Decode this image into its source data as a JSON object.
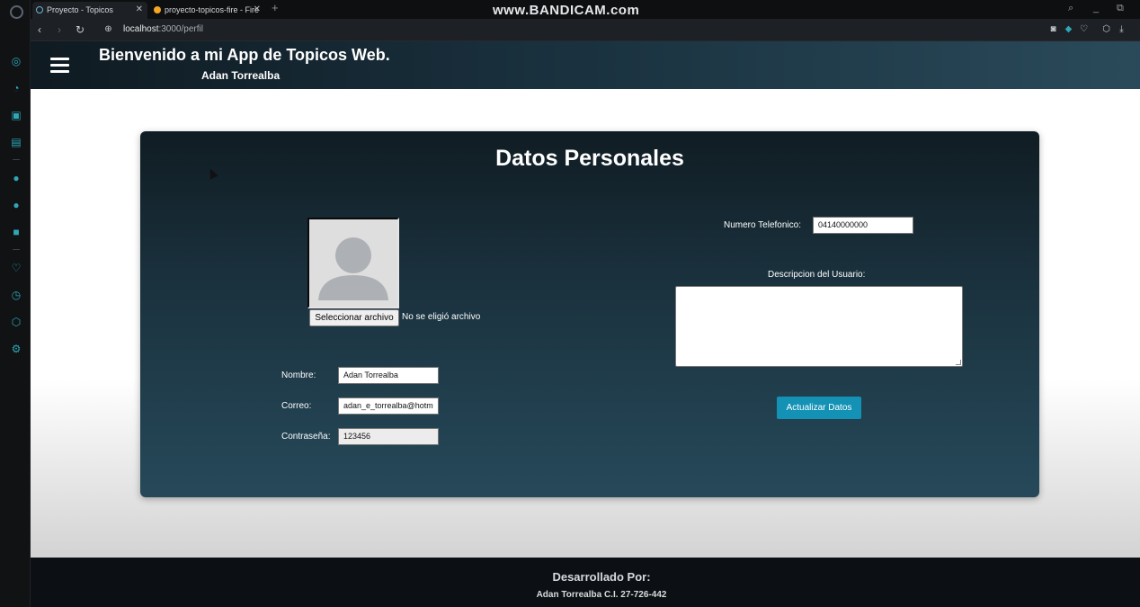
{
  "browser": {
    "tabs": [
      {
        "title": "Proyecto - Topicos",
        "close": "✕"
      },
      {
        "title": "proyecto-topicos-fire - Fire",
        "close": "✕"
      }
    ],
    "new_tab": "+",
    "recorder_watermark": "www.BANDICAM.com",
    "url_host": "localhost",
    "url_path": ":3000/perfil",
    "controls": {
      "search": "⌕",
      "minimize": "_",
      "restore": "⧉"
    },
    "nav": {
      "back": "‹",
      "forward": "›",
      "reload": "↻"
    }
  },
  "header": {
    "title": "Bienvenido a mi App de Topicos Web.",
    "user": "Adan Torrealba"
  },
  "card": {
    "title": "Datos Personales",
    "file_button": "Seleccionar archivo",
    "file_status": "No se eligió archivo",
    "fields": {
      "nombre_label": "Nombre:",
      "nombre_value": "Adan Torrealba",
      "correo_label": "Correo:",
      "correo_value": "adan_e_torrealba@hotm",
      "password_label": "Contraseña:",
      "password_value": "123456",
      "telefono_label": "Numero Telefonico:",
      "telefono_value": "04140000000",
      "descripcion_label": "Descripcion del Usuario:",
      "descripcion_value": ""
    },
    "update_button": "Actualizar Datos"
  },
  "footer": {
    "title": "Desarrollado Por:",
    "credit": "Adan Torrealba C.I. 27-726-442"
  },
  "colors": {
    "accent_button": "#1392b5",
    "header_dark": "#0f1a21",
    "card_dark": "#101c23",
    "rail_accent": "#2ea7b6"
  }
}
